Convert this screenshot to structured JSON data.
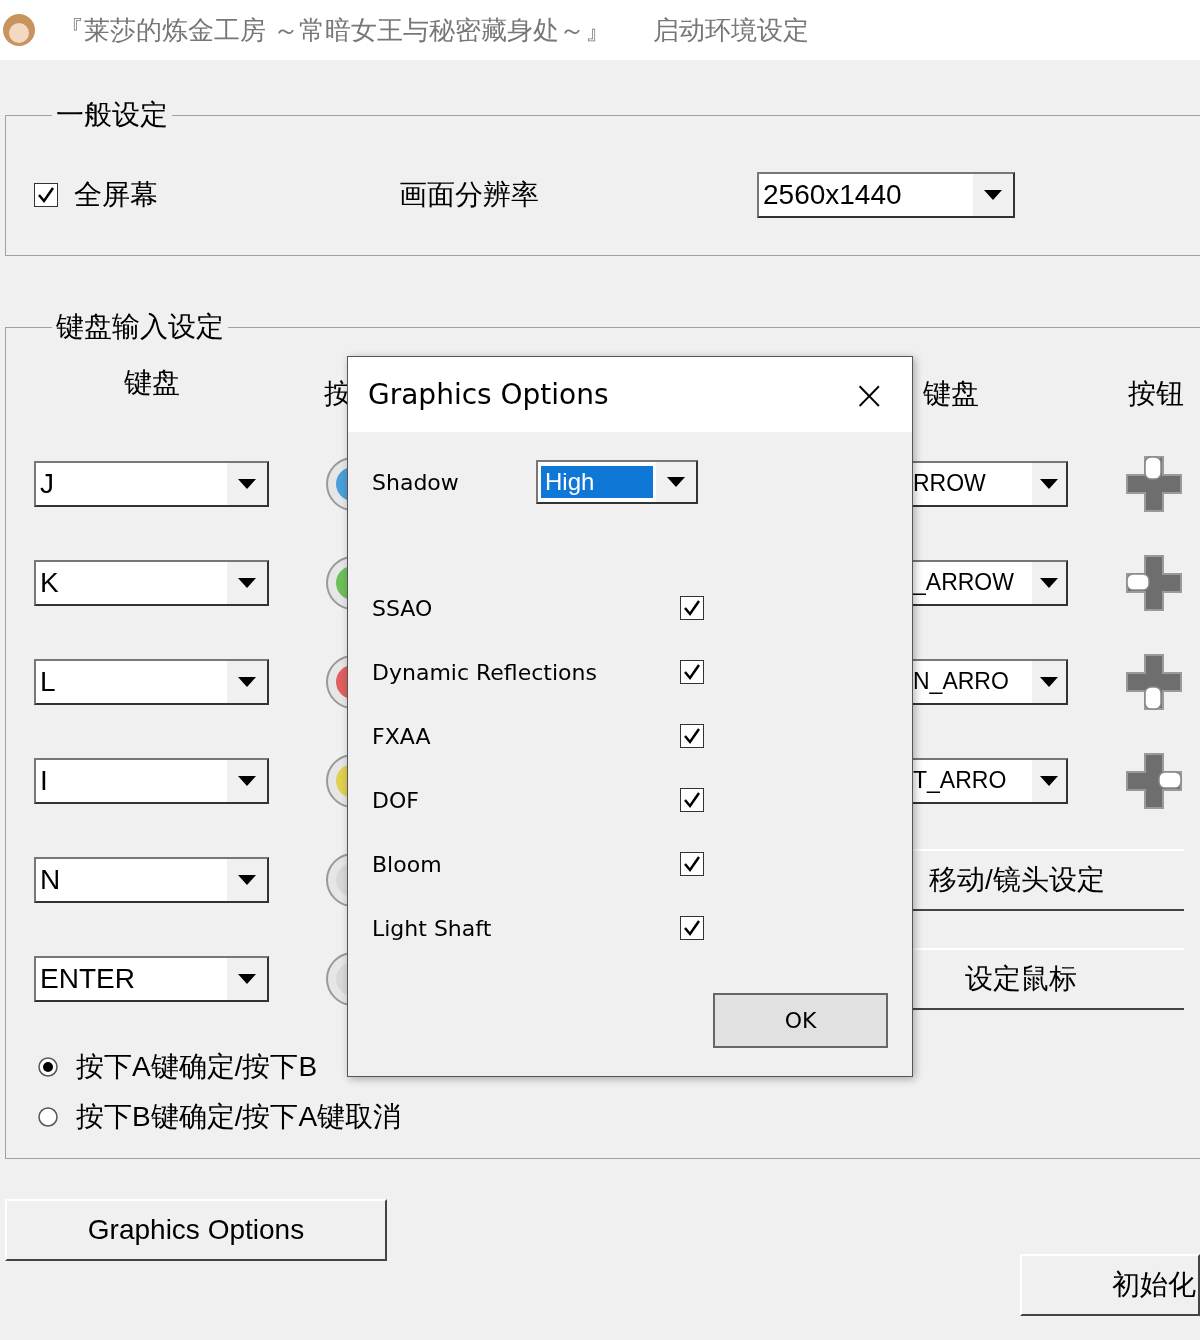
{
  "window": {
    "title": "『莱莎的炼金工房 ～常暗女王与秘密藏身处～』",
    "subtitle": "启动环境设定"
  },
  "general": {
    "title": "一般设定",
    "fullscreen": {
      "label": "全屏幕",
      "checked": true
    },
    "resolution": {
      "label": "画面分辨率",
      "value": "2560x1440"
    }
  },
  "keyboard": {
    "title": "键盘输入设定",
    "left_header": "键盘",
    "middle_header": "按",
    "right_header": "键盘",
    "button_header": "按钮",
    "left_keys": [
      "J",
      "K",
      "L",
      "I",
      "N",
      "ENTER"
    ],
    "pad_buttons": [
      {
        "color": "#4a9fd8"
      },
      {
        "color": "#6cbf5a"
      },
      {
        "color": "#e06060"
      },
      {
        "color": "#e0d050"
      },
      {
        "color": "#d8d8d8"
      },
      {
        "color": "#d8d8d8"
      }
    ],
    "right_keys": [
      {
        "value": "RROW",
        "kind": "up"
      },
      {
        "value": "_ARROW",
        "kind": "left"
      },
      {
        "value": "N_ARRO",
        "kind": "down"
      },
      {
        "value": "T_ARRO",
        "kind": "right"
      }
    ],
    "actions": [
      "移动/镜头设定",
      "设定鼠标"
    ],
    "radios": [
      {
        "label": "按下A键确定/按下B",
        "selected": true
      },
      {
        "label": "按下B键确定/按下A键取消",
        "selected": false
      }
    ]
  },
  "buttons": {
    "graphics": "Graphics Options",
    "reset": "初始化"
  },
  "dialog": {
    "title": "Graphics Options",
    "close": "×",
    "shadow": {
      "label": "Shadow",
      "value": "High"
    },
    "options": [
      {
        "label": "SSAO",
        "checked": true
      },
      {
        "label": "Dynamic Reflections",
        "checked": true
      },
      {
        "label": "FXAA",
        "checked": true
      },
      {
        "label": "DOF",
        "checked": true
      },
      {
        "label": "Bloom",
        "checked": true
      },
      {
        "label": "Light Shaft",
        "checked": true
      }
    ],
    "ok": "OK"
  }
}
